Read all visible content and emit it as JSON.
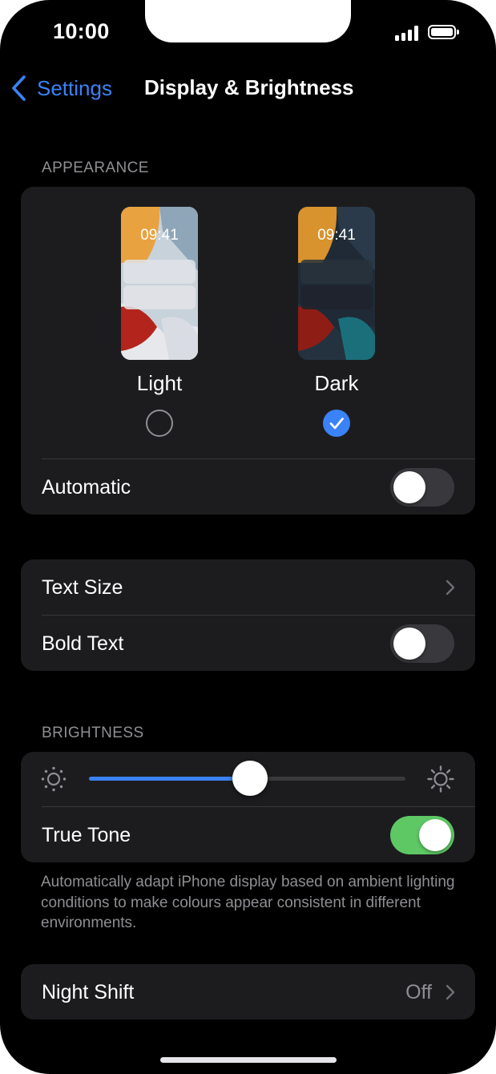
{
  "status_bar": {
    "time": "10:00",
    "signal_icon": "cellular-signal-icon",
    "battery_icon": "battery-full-icon"
  },
  "nav": {
    "back_label": "Settings",
    "title": "Display & Brightness",
    "back_icon": "chevron-left-icon"
  },
  "appearance": {
    "header": "APPEARANCE",
    "light": {
      "label": "Light",
      "preview_time": "09:41",
      "selected": false
    },
    "dark": {
      "label": "Dark",
      "preview_time": "09:41",
      "selected": true
    },
    "automatic": {
      "label": "Automatic",
      "on": false
    }
  },
  "text": {
    "text_size": {
      "label": "Text Size"
    },
    "bold_text": {
      "label": "Bold Text",
      "on": false
    }
  },
  "brightness": {
    "header": "BRIGHTNESS",
    "level": 0.51,
    "true_tone": {
      "label": "True Tone",
      "on": true
    },
    "footnote": "Automatically adapt iPhone display based on ambient lighting conditions to make colours appear consistent in different environments."
  },
  "night_shift": {
    "label": "Night Shift",
    "value": "Off"
  },
  "colors": {
    "accent": "#3b82f6",
    "toggle_on": "#5ec864",
    "group_bg": "#1c1c1e",
    "secondary_text": "#8e8e93"
  }
}
